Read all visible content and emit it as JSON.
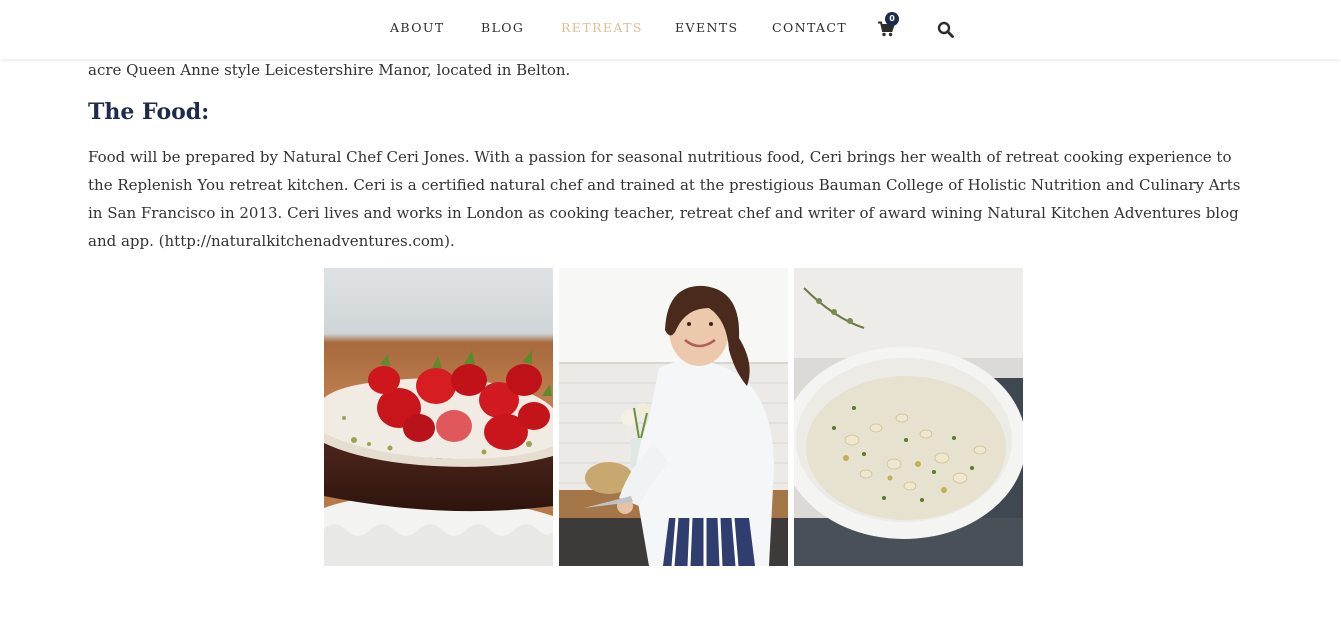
{
  "nav": {
    "items": [
      {
        "label": "ABOUT"
      },
      {
        "label": "BLOG"
      },
      {
        "label": "RETREATS"
      },
      {
        "label": "EVENTS"
      },
      {
        "label": "CONTACT"
      }
    ],
    "cart_count": "0",
    "active_color": "#e0bf8f",
    "cart_icon": "shopping-cart-icon",
    "search_icon": "search-icon"
  },
  "content": {
    "intro_tail": "acre Queen Anne style Leicestershire Manor, located in Belton.",
    "section_title": "The Food:",
    "paragraph_text": "Food will be prepared by Natural Chef Ceri Jones.  With a passion for seasonal nutritious food, Ceri brings her wealth of retreat cooking experience to the Replenish You retreat kitchen. Ceri is a certified natural chef and trained at the prestigious Bauman College of Holistic Nutrition and Culinary Arts in San Francisco in 2013. Ceri lives and works in London as cooking teacher, retreat chef and writer of award wining Natural Kitchen Adventures blog and app. (",
    "paragraph_link": "http://naturalkitchenadventures.com",
    "paragraph_end": ").",
    "title_color": "#1f2b4d"
  },
  "gallery": {
    "images": [
      {
        "subject": "strawberry-cake-photo"
      },
      {
        "subject": "chef-portrait-photo"
      },
      {
        "subject": "soup-bowl-photo"
      }
    ]
  }
}
